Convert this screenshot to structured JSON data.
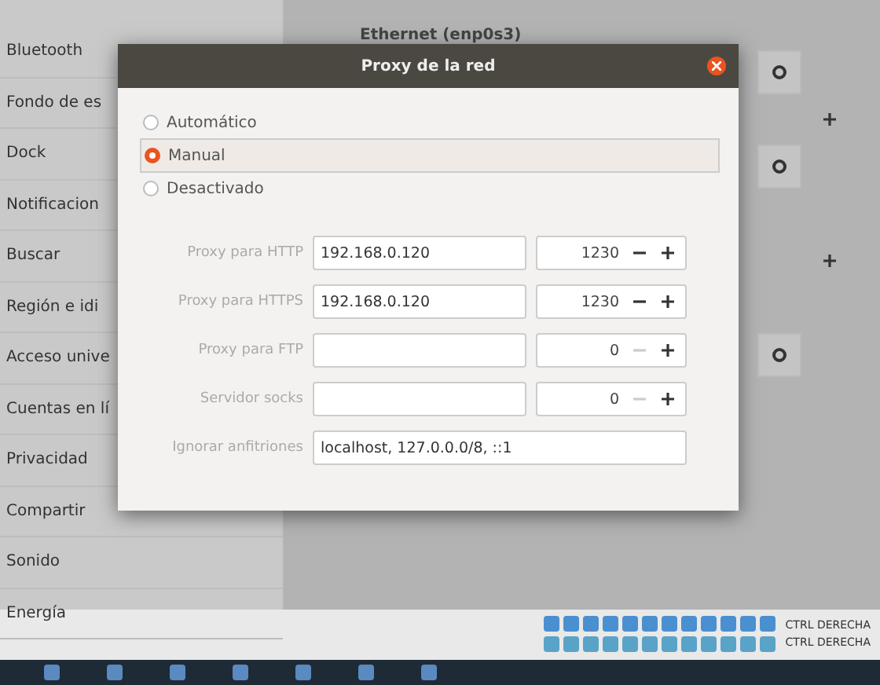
{
  "sidebar": {
    "items": [
      {
        "label": "Bluetooth"
      },
      {
        "label": "Fondo de es"
      },
      {
        "label": "Dock"
      },
      {
        "label": "Notificacion"
      },
      {
        "label": "Buscar"
      },
      {
        "label": "Región e idi"
      },
      {
        "label": "Acceso unive"
      },
      {
        "label": "Cuentas en lí"
      },
      {
        "label": "Privacidad"
      },
      {
        "label": "Compartir"
      },
      {
        "label": "Sonido"
      },
      {
        "label": "Energía"
      }
    ]
  },
  "network_panel": {
    "heading": "Ethernet (enp0s3)"
  },
  "dialog": {
    "title": "Proxy de la red",
    "modes": [
      {
        "label": "Automático",
        "selected": false
      },
      {
        "label": "Manual",
        "selected": true
      },
      {
        "label": "Desactivado",
        "selected": false
      }
    ],
    "proxies": [
      {
        "label": "Proxy para HTTP",
        "value": "192.168.0.120",
        "port": "1230",
        "minus_disabled": false
      },
      {
        "label": "Proxy para HTTPS",
        "value": "192.168.0.120",
        "port": "1230",
        "minus_disabled": false
      },
      {
        "label": "Proxy para FTP",
        "port": "0",
        "minus_disabled": true
      },
      {
        "label": "Servidor socks",
        "port": "0",
        "minus_disabled": true
      }
    ],
    "ignore_hosts": {
      "label": "Ignorar anfitriones",
      "value": "localhost, 127.0.0.0/8, ::1"
    }
  },
  "status_bar": {
    "host_key": [
      "CTRL DERECHA",
      "CTRL DERECHA"
    ]
  }
}
